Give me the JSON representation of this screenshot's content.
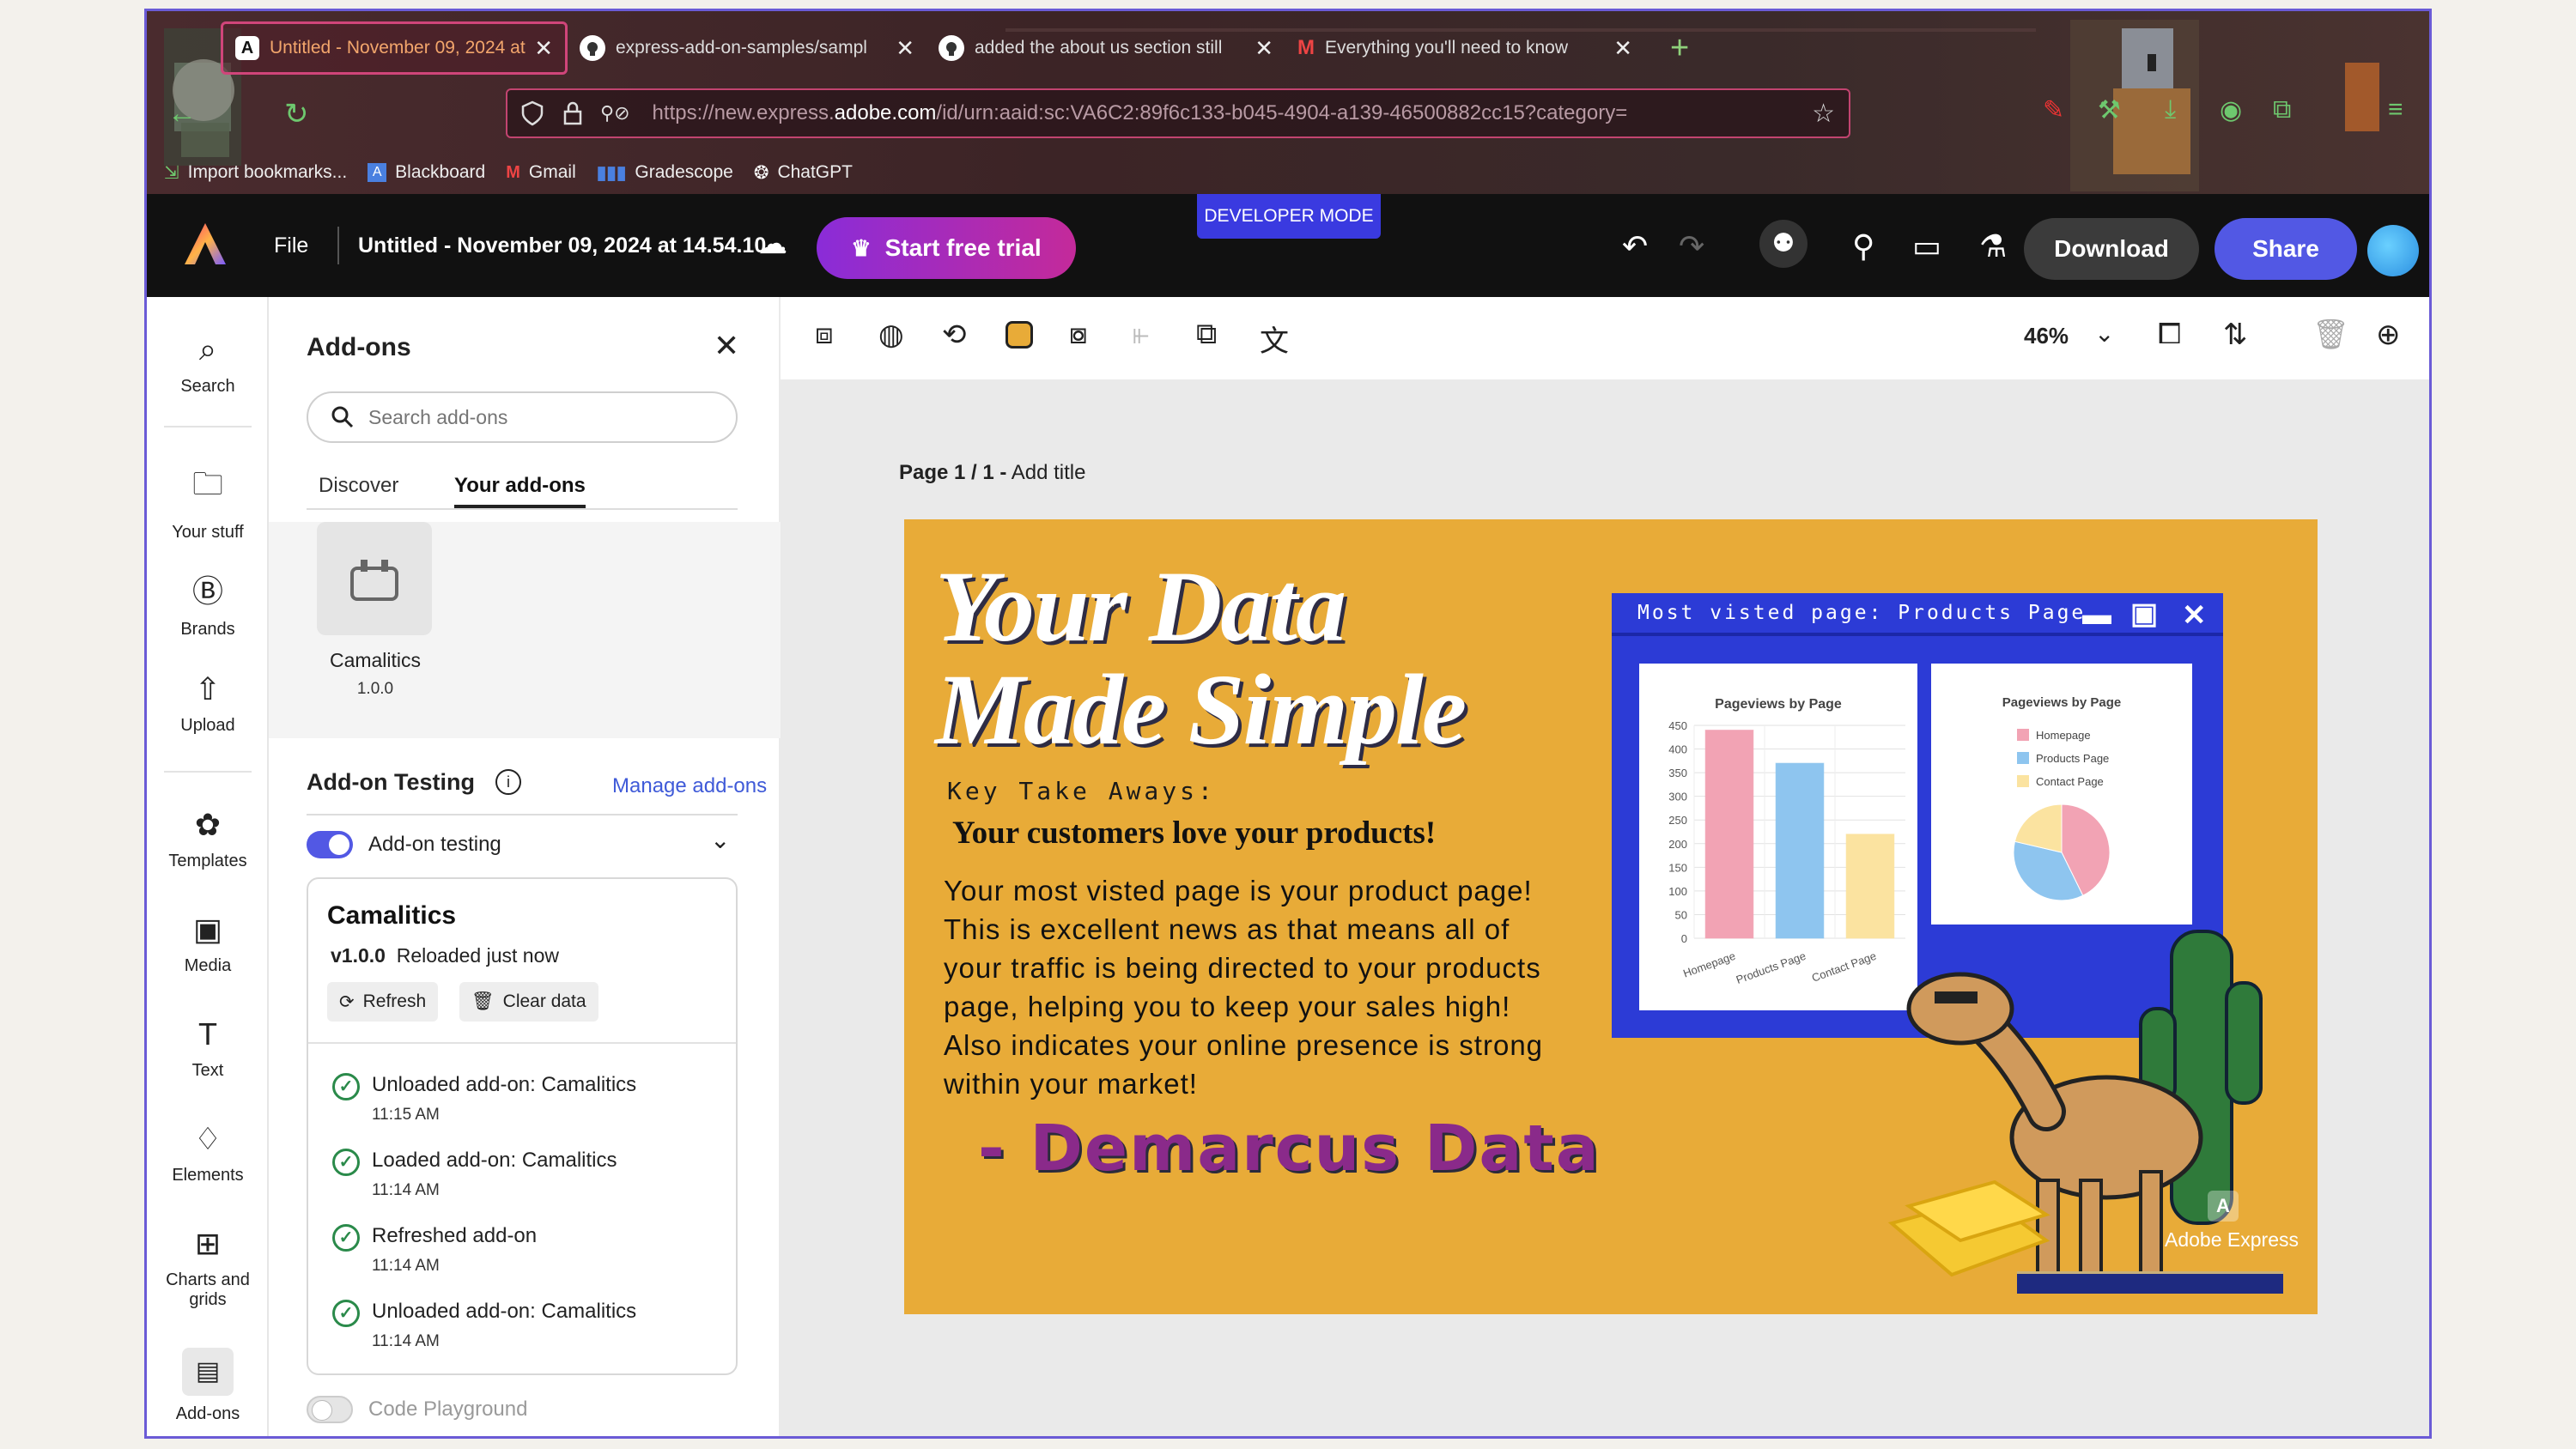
{
  "browser": {
    "tabs": [
      {
        "label": "Untitled - November 09, 2024 at",
        "icon": "adobe-express-icon",
        "active": true
      },
      {
        "label": "express-add-on-samples/sampl",
        "icon": "github-icon",
        "active": false
      },
      {
        "label": "added the about us section still",
        "icon": "github-icon",
        "active": false
      },
      {
        "label": "Everything you'll need to know",
        "icon": "gmail-icon",
        "active": false
      }
    ],
    "url_prefix": "https://new.express.",
    "url_domain": "adobe.com",
    "url_suffix": "/id/urn:aaid:sc:VA6C2:89f6c133-b045-4904-a139-46500882cc15?category=",
    "bookmarks": [
      "Import bookmarks...",
      "Blackboard",
      "Gmail",
      "Gradescope",
      "ChatGPT"
    ]
  },
  "app": {
    "file_label": "File",
    "doc_title": "Untitled - November 09, 2024 at 14.54.10",
    "trial_label": "Start free trial",
    "dev_mode": "DEVELOPER MODE",
    "download_label": "Download",
    "share_label": "Share"
  },
  "rail": {
    "items": [
      {
        "label": "Search",
        "icon": "search-icon"
      },
      {
        "label": "Your stuff",
        "icon": "folder-icon"
      },
      {
        "label": "Brands",
        "icon": "brand-icon"
      },
      {
        "label": "Upload",
        "icon": "upload-icon"
      },
      {
        "label": "Templates",
        "icon": "templates-icon"
      },
      {
        "label": "Media",
        "icon": "media-icon"
      },
      {
        "label": "Text",
        "icon": "text-icon"
      },
      {
        "label": "Elements",
        "icon": "elements-icon"
      },
      {
        "label": "Charts and grids",
        "icon": "charts-icon"
      },
      {
        "label": "Add-ons",
        "icon": "addons-icon"
      }
    ]
  },
  "panel": {
    "title": "Add-ons",
    "search_placeholder": "Search add-ons",
    "tabs": [
      "Discover",
      "Your add-ons"
    ],
    "addon_name": "Camalitics",
    "addon_version": "1.0.0",
    "testing_title": "Add-on Testing",
    "manage_label": "Manage add-ons",
    "toggle_label": "Add-on testing",
    "card": {
      "title": "Camalitics",
      "version": "v1.0.0",
      "status": "Reloaded just now",
      "refresh": "Refresh",
      "clear": "Clear data",
      "logs": [
        {
          "text": "Unloaded add-on: Camalitics",
          "time": "11:15 AM"
        },
        {
          "text": "Loaded add-on: Camalitics",
          "time": "11:14 AM"
        },
        {
          "text": "Refreshed add-on",
          "time": "11:14 AM"
        },
        {
          "text": "Unloaded add-on: Camalitics",
          "time": "11:14 AM"
        }
      ]
    },
    "playground_label": "Code Playground"
  },
  "canvas": {
    "zoom": "46%",
    "page_label": "Page 1 / 1 -",
    "page_title_hint": "Add title"
  },
  "slide": {
    "headline_1": "Your Data",
    "headline_2": "Made Simple",
    "key_title": "Key Take Aways:",
    "key_headline": "Your customers love your products!",
    "body": "Your most visted page is your product page! This is excellent news as that means all of your traffic is being directed to your products page, helping you to keep your sales high! Also indicates your online presence is strong within your market!",
    "signature": "- Demarcus Data",
    "window_title": "Most visted page: Products Page",
    "watermark": "Adobe Express",
    "colors": {
      "background": "#e8ab38",
      "window": "#2c3bd6",
      "signature": "#8a2a8a"
    }
  },
  "chart_data": [
    {
      "type": "bar",
      "title": "Pageviews by Page",
      "categories": [
        "Homepage",
        "Products Page",
        "Contact Page"
      ],
      "values": [
        440,
        370,
        220
      ],
      "colors": [
        "#f2a3b4",
        "#8ec5ef",
        "#fbe3a0"
      ],
      "ylim": [
        0,
        450
      ],
      "yticks": [
        0,
        50,
        100,
        150,
        200,
        250,
        300,
        350,
        400,
        450
      ],
      "grid": true
    },
    {
      "type": "pie",
      "title": "Pageviews by Page",
      "labels": [
        "Homepage",
        "Products Page",
        "Contact Page"
      ],
      "values": [
        440,
        370,
        220
      ],
      "colors": [
        "#f2a3b4",
        "#8ec5ef",
        "#fbe3a0"
      ],
      "legend": "top"
    }
  ]
}
